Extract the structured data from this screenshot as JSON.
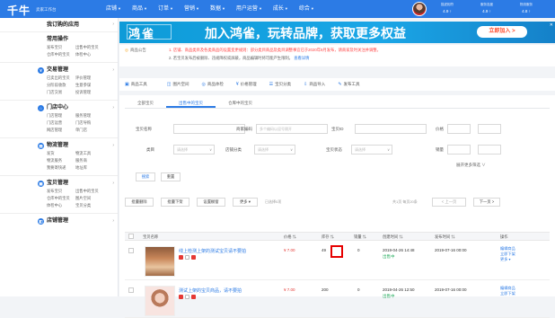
{
  "topbar": {
    "logo": "千牛",
    "logo_sub": "卖家工作台",
    "nav": [
      "店铺",
      "商品",
      "订单",
      "营销",
      "数据",
      "用户运营",
      "成长",
      "综合"
    ],
    "stats": [
      {
        "label": "描述相符",
        "value": "4.9 ↑"
      },
      {
        "label": "服务态度",
        "value": "4.9 ↑"
      },
      {
        "label": "物流服务",
        "value": "4.8 ↑"
      }
    ]
  },
  "sidebar": {
    "my_apps": "我订购的应用",
    "sections": [
      {
        "title": "常用操作",
        "icon": "",
        "links": [
          "发布宝贝",
          "出售中的宝贝",
          "仓库中的宝贝",
          "体检中心"
        ]
      },
      {
        "title": "交易管理",
        "icon": "¥",
        "links": [
          "已卖出的宝贝",
          "评价管理",
          "分阶段收款",
          "生意参谋",
          "门店交易",
          "投诉管理"
        ]
      },
      {
        "title": "门店中心",
        "icon": "⌂",
        "links": [
          "门店管理",
          "服务管理",
          "门店运营",
          "门店导购",
          "网店管理",
          "单门店"
        ]
      },
      {
        "title": "物流管理",
        "icon": "▤",
        "links": [
          "发货",
          "物流工具",
          "物流服务",
          "服务商",
          "我要寄快递",
          "地址库"
        ]
      },
      {
        "title": "宝贝管理",
        "icon": "▣",
        "links": [
          "发布宝贝",
          "出售中的宝贝",
          "仓库中的宝贝",
          "图片空间",
          "体检中心",
          "宝贝分类"
        ]
      },
      {
        "title": "店铺管理",
        "icon": "◧",
        "links": []
      }
    ]
  },
  "banner": {
    "brand": "鸿雀",
    "slogan": "加入鸿雀，玩转品牌，获取更多权益",
    "cta": "立即加入 >",
    "close": "✕"
  },
  "notice": {
    "label": "商品公告",
    "line1": "1. 店铺、商品类目及各类商品的设置变更规则：部分类目商品及类目调整事宜已于2020年9月发布，请商家及时关注并调整。",
    "line2_text": "2. 若宝贝发布后被删除、违规降权或屏蔽，商品编辑时将可能产生限制。",
    "line2_link": "查看详情"
  },
  "tools": [
    "商品工具",
    "图片空间",
    "商品体检",
    "价格管理",
    "宝贝分类",
    "商品导入",
    "发布工具"
  ],
  "tabs": [
    "全部宝贝",
    "出售中的宝贝",
    "仓库中的宝贝"
  ],
  "filters": {
    "name_label": "宝贝名称",
    "code_label": "商家编码",
    "code_placeholder": "多个编码以逗号隔开",
    "id_label": "宝贝ID",
    "price_label": "价格",
    "cat_label": "类目",
    "cat_placeholder": "请选择",
    "shopcat_label": "店铺分类",
    "shopcat_placeholder": "请选择",
    "status_label": "宝贝状态",
    "status_placeholder": "请选择",
    "sales_label": "销量",
    "expand": "展开更多筛选 ∨",
    "search_btn": "搜索",
    "reset_btn": "重置"
  },
  "bulk": {
    "btns": [
      "批量删除",
      "批量下架",
      "设置橱窗",
      "更多 ▾"
    ],
    "selected": "已选择0项",
    "pagination": "共1页 每页20条",
    "prev": "< 上一页",
    "next": "下一页 >"
  },
  "table": {
    "headers": [
      "宝贝名称",
      "价格 ⇅",
      "库存 ⇅",
      "销量 ⇅",
      "创建时间 ⇅",
      "发布时间 ⇅",
      "操作"
    ],
    "rows": [
      {
        "title": "线上检测上架的测试宝贝请不要拍",
        "price": "¥ 7.00",
        "stock": "49",
        "sales": "0",
        "created": "2019-04-26 14:48",
        "status": "出售中",
        "published": "2019-07-16 00:00",
        "ops": [
          "编辑商品",
          "立即下架",
          "更多 ▾"
        ]
      },
      {
        "title": "测试上架的宝贝商品，请不要拍",
        "price": "¥ 7.00",
        "stock": "200",
        "sales": "0",
        "created": "2019-04-26 12:50",
        "status": "出售中",
        "published": "2019-07-16 00:00",
        "ops": [
          "编辑商品",
          "立即下架"
        ]
      }
    ]
  }
}
